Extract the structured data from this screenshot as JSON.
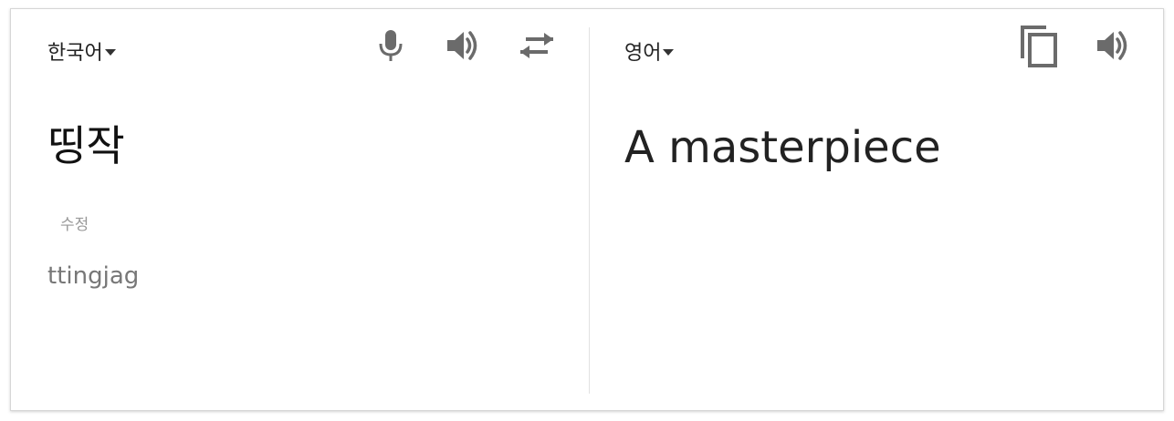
{
  "source": {
    "language": "한국어",
    "text": "띵작",
    "edit_label": "수정",
    "romanization": "ttingjag"
  },
  "target": {
    "language": "영어",
    "text": "A masterpiece"
  },
  "icons": {
    "mic": "microphone-icon",
    "source_speaker": "speaker-icon",
    "swap": "swap-arrows-icon",
    "copy": "copy-icon",
    "target_speaker": "speaker-icon"
  },
  "colors": {
    "icon": "#6b6b6b",
    "text_primary": "#222222",
    "text_muted": "#999999"
  }
}
